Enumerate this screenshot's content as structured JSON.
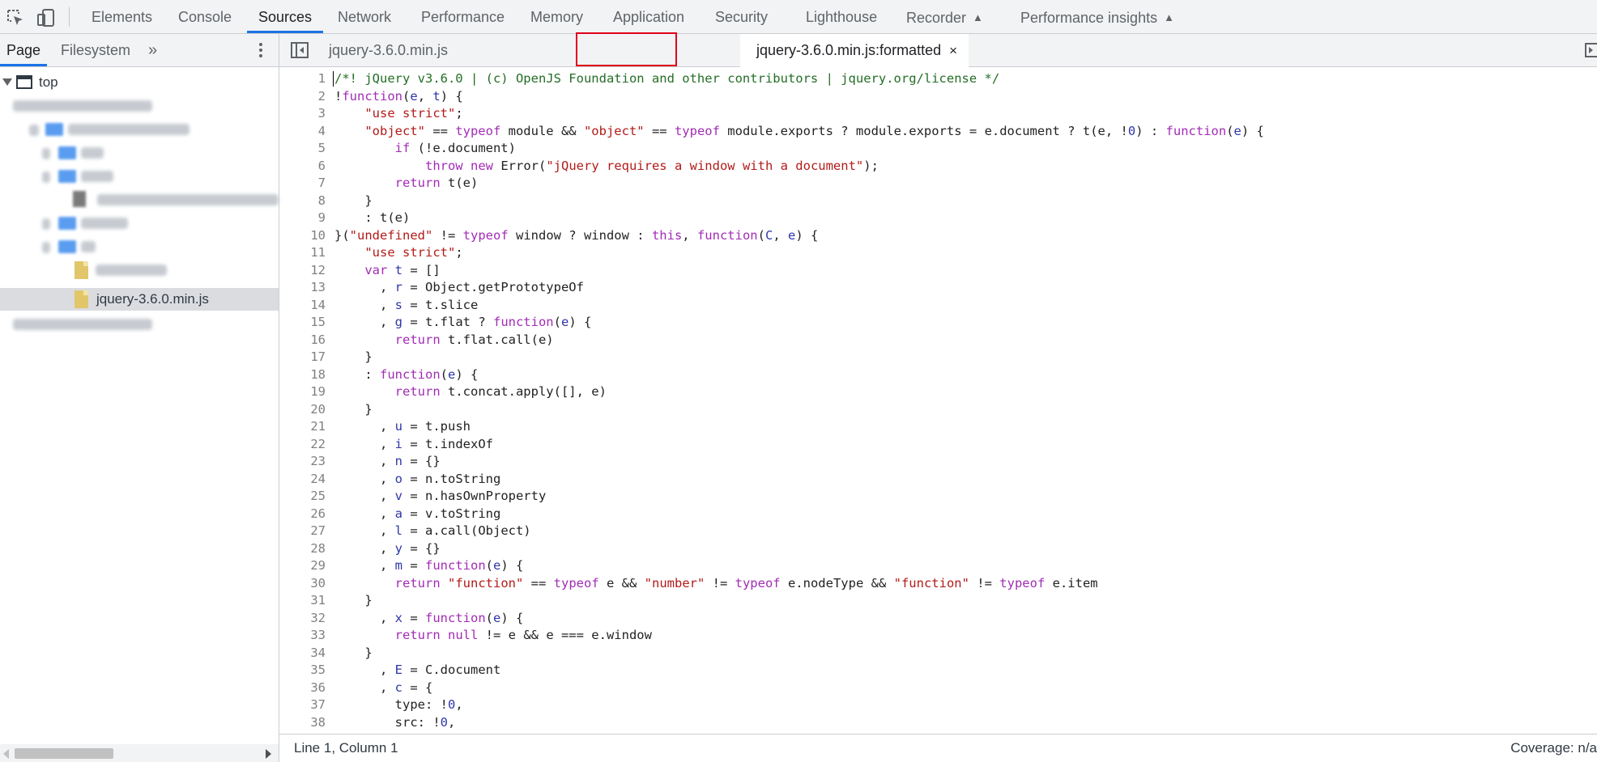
{
  "toolbar": {
    "tabs": [
      {
        "label": "Elements"
      },
      {
        "label": "Console"
      },
      {
        "label": "Sources"
      },
      {
        "label": "Network"
      },
      {
        "label": "Performance"
      },
      {
        "label": "Memory"
      },
      {
        "label": "Application"
      },
      {
        "label": "Security"
      },
      {
        "label": "Lighthouse"
      },
      {
        "label": "Recorder",
        "icon": "flask-icon"
      },
      {
        "label": "Performance insights",
        "icon": "flask-icon"
      }
    ],
    "active_tab": "Sources",
    "icons": [
      "inspect-element-icon",
      "device-toolbar-icon"
    ]
  },
  "navigator": {
    "tabs": [
      {
        "label": "Page"
      },
      {
        "label": "Filesystem"
      }
    ],
    "more": "»",
    "tree": {
      "root_label": "top",
      "selected_file": "jquery-3.6.0.min.js"
    }
  },
  "editor": {
    "tabs": [
      {
        "label": "jquery-3.6.0.min.js"
      },
      {
        "label": "jquery-3.6.0.min.js:formatted",
        "close": "×"
      }
    ],
    "line_numbers": [
      "1",
      "2",
      "3",
      "4",
      "5",
      "6",
      "7",
      "8",
      "9",
      "10",
      "11",
      "12",
      "13",
      "14",
      "15",
      "16",
      "17",
      "18",
      "19",
      "20",
      "21",
      "22",
      "23",
      "24",
      "25",
      "26",
      "27",
      "28",
      "29",
      "30",
      "31",
      "32",
      "33",
      "34",
      "35",
      "36",
      "37",
      "38"
    ]
  },
  "status": {
    "position": "Line 1, Column 1",
    "coverage": "Coverage: n/a"
  },
  "colors": {
    "accent": "#1a73e8",
    "highlight_box": "#e0001b",
    "comment": "#236e25",
    "string": "#b21b19",
    "keyword": "#a22cb5",
    "variable": "#2e36a6"
  }
}
